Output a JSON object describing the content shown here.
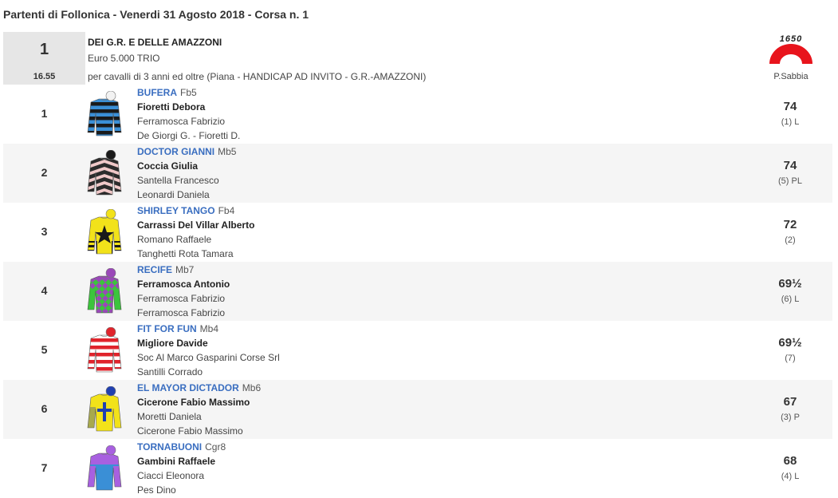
{
  "page": {
    "title": "Partenti di Follonica - Venerdi 31 Agosto 2018 - Corsa n. 1"
  },
  "race": {
    "number": "1",
    "time": "16.55",
    "name": "DEI G.R. E DELLE AMAZZONI",
    "prize": "Euro 5.000 TRIO",
    "description": "per cavalli di 3 anni ed oltre (Piana -  HANDICAP AD INVITO  - G.R.-AMAZZONI)",
    "track_code": "1650",
    "track_label": "P.Sabbia",
    "logo_color": "#e8141c"
  },
  "runners": [
    {
      "num": "1",
      "horse": "BUFERA",
      "code": "Fb5",
      "jockey": "Fioretti Debora",
      "owner": "Ferramosca Fabrizio",
      "trainer": "De Giorgi G. - Fioretti D.",
      "weight": "74",
      "draw": "(1) L",
      "silk": {
        "type": "hoops",
        "c1": "#3a8fd6",
        "c2": "#1a1a1a",
        "cap": "#f2f2f2"
      }
    },
    {
      "num": "2",
      "horse": "DOCTOR GIANNI",
      "code": "Mb5",
      "jockey": "Coccia Giulia",
      "owner": "Santella Francesco",
      "trainer": "Leonardi Daniela",
      "weight": "74",
      "draw": "(5) PL",
      "silk": {
        "type": "chevrons",
        "c1": "#2b2b2b",
        "c2": "#f0c8c8",
        "cap": "#1a1a1a"
      }
    },
    {
      "num": "3",
      "horse": "SHIRLEY TANGO",
      "code": "Fb4",
      "jockey": "Carrassi Del Villar Alberto",
      "owner": "Romano Raffaele",
      "trainer": "Tanghetti Rota Tamara",
      "weight": "72",
      "draw": "(2)",
      "silk": {
        "type": "star",
        "c1": "#f2e21a",
        "c2": "#1a1a1a",
        "cap": "#f2e21a"
      }
    },
    {
      "num": "4",
      "horse": "RECIFE",
      "code": "Mb7",
      "jockey": "Ferramosca Antonio",
      "owner": "Ferramosca Fabrizio",
      "trainer": "Ferramosca Fabrizio",
      "weight": "69½",
      "draw": "(6) L",
      "silk": {
        "type": "diamonds",
        "c1": "#9a48b8",
        "c2": "#3cc43c",
        "cap": "#9a48b8"
      }
    },
    {
      "num": "5",
      "horse": "FIT FOR FUN",
      "code": "Mb4",
      "jockey": "Migliore Davide",
      "owner": "Soc Al Marco Gasparini Corse Srl",
      "trainer": "Santilli Corrado",
      "weight": "69½",
      "draw": "(7)",
      "silk": {
        "type": "hoops",
        "c1": "#ffffff",
        "c2": "#e0242c",
        "cap": "#e0242c"
      }
    },
    {
      "num": "6",
      "horse": "EL MAYOR DICTADOR",
      "code": "Mb6",
      "jockey": "Cicerone Fabio Massimo",
      "owner": "Moretti Daniela",
      "trainer": "Cicerone Fabio Massimo",
      "weight": "67",
      "draw": "(3) P",
      "silk": {
        "type": "cross",
        "c1": "#f2e21a",
        "c2": "#2040b0",
        "cap": "#2040b0"
      }
    },
    {
      "num": "7",
      "horse": "TORNABUONI",
      "code": "Cgr8",
      "jockey": "Gambini Raffaele",
      "owner": "Ciacci Eleonora",
      "trainer": "Pes Dino",
      "weight": "68",
      "draw": "(4) L",
      "silk": {
        "type": "split",
        "c1": "#3a8fd6",
        "c2": "#a860e0",
        "cap": "#a860e0"
      }
    }
  ]
}
